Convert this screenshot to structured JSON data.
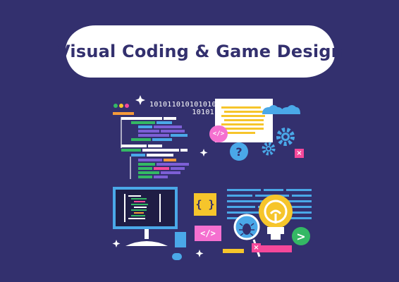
{
  "title": "Visual Coding & Game Design",
  "binary": {
    "line1": "1010110101010101",
    "line2": "10101"
  },
  "badges": {
    "braces": "{ }",
    "tag_small": "</>",
    "tag_large": "</>",
    "question": "?",
    "close": "×",
    "play": ">"
  },
  "colors": {
    "background": "#33306e",
    "white": "#ffffff",
    "green": "#34b864",
    "purple": "#7d5fd6",
    "blue": "#4aa8e8",
    "yellow": "#f6c52b",
    "pink": "#f570d0",
    "red": "#f5489a",
    "orange": "#f59a3a"
  },
  "icons": [
    "gear-icon",
    "cloud-icon",
    "monitor-icon",
    "magnifier-icon",
    "bug-icon",
    "lightbulb-icon",
    "sparkle-icon"
  ]
}
